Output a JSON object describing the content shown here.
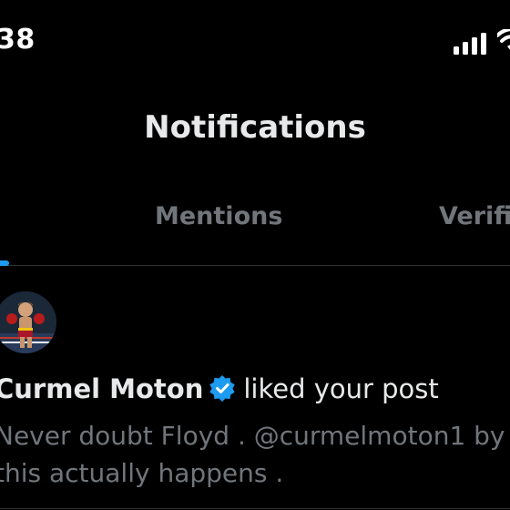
{
  "status_bar": {
    "time": "38",
    "signal_icon": "cellular-signal-icon",
    "wifi_icon": "wifi-icon"
  },
  "header": {
    "title": "Notifications"
  },
  "tabs": [
    {
      "label": "Mentions"
    },
    {
      "label": "Verifi"
    }
  ],
  "colors": {
    "accent": "#1d9bf0",
    "background": "#000000",
    "primary_text": "#e7e9ea",
    "secondary_text": "#71767b",
    "divider": "#2f3336"
  },
  "notification": {
    "author": "Curmel Moton",
    "verified_icon": "verified-badge-icon",
    "action": "liked your post",
    "post_lines": [
      "Never doubt Floyd . @curmelmoton1 by",
      "this actually happens ."
    ]
  }
}
